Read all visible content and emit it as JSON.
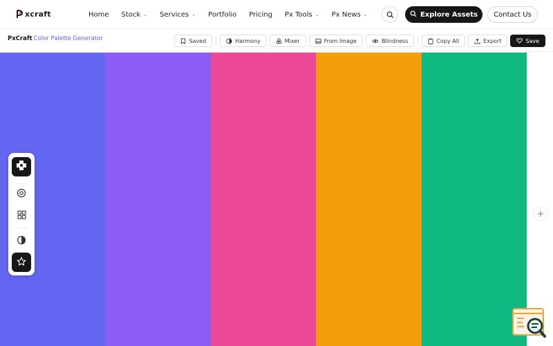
{
  "nav": {
    "logo_text": "xcraft",
    "links": [
      {
        "label": "Home",
        "has_dropdown": false
      },
      {
        "label": "Stock",
        "has_dropdown": true
      },
      {
        "label": "Services",
        "has_dropdown": true
      },
      {
        "label": "Portfolio",
        "has_dropdown": false
      },
      {
        "label": "Pricing",
        "has_dropdown": false
      },
      {
        "label": "Px Tools",
        "has_dropdown": true
      },
      {
        "label": "Px News",
        "has_dropdown": true
      }
    ],
    "search_icon": "search-icon",
    "explore_label": "Explore Assets",
    "contact_label": "Contact Us"
  },
  "toolbar": {
    "brand_name": "PxCraft",
    "brand_subtitle": "Color Palette Generator",
    "buttons": {
      "saved": "Saved",
      "harmony": "Harmony",
      "mixer": "Mixer",
      "from_image": "From Image",
      "blindness": "Blindness",
      "copy_all": "Copy All",
      "export": "Export",
      "save": "Save"
    }
  },
  "palette": {
    "colors": [
      "#6366f1",
      "#8b5cf6",
      "#ec4899",
      "#f59e0b",
      "#10b981"
    ]
  },
  "side_panel": {
    "icons": [
      "palette-logo-icon",
      "settings-target-icon",
      "grid-icon",
      "contrast-icon",
      "star-icon"
    ]
  },
  "accent": "#5b5ef0",
  "dark": "#171717"
}
